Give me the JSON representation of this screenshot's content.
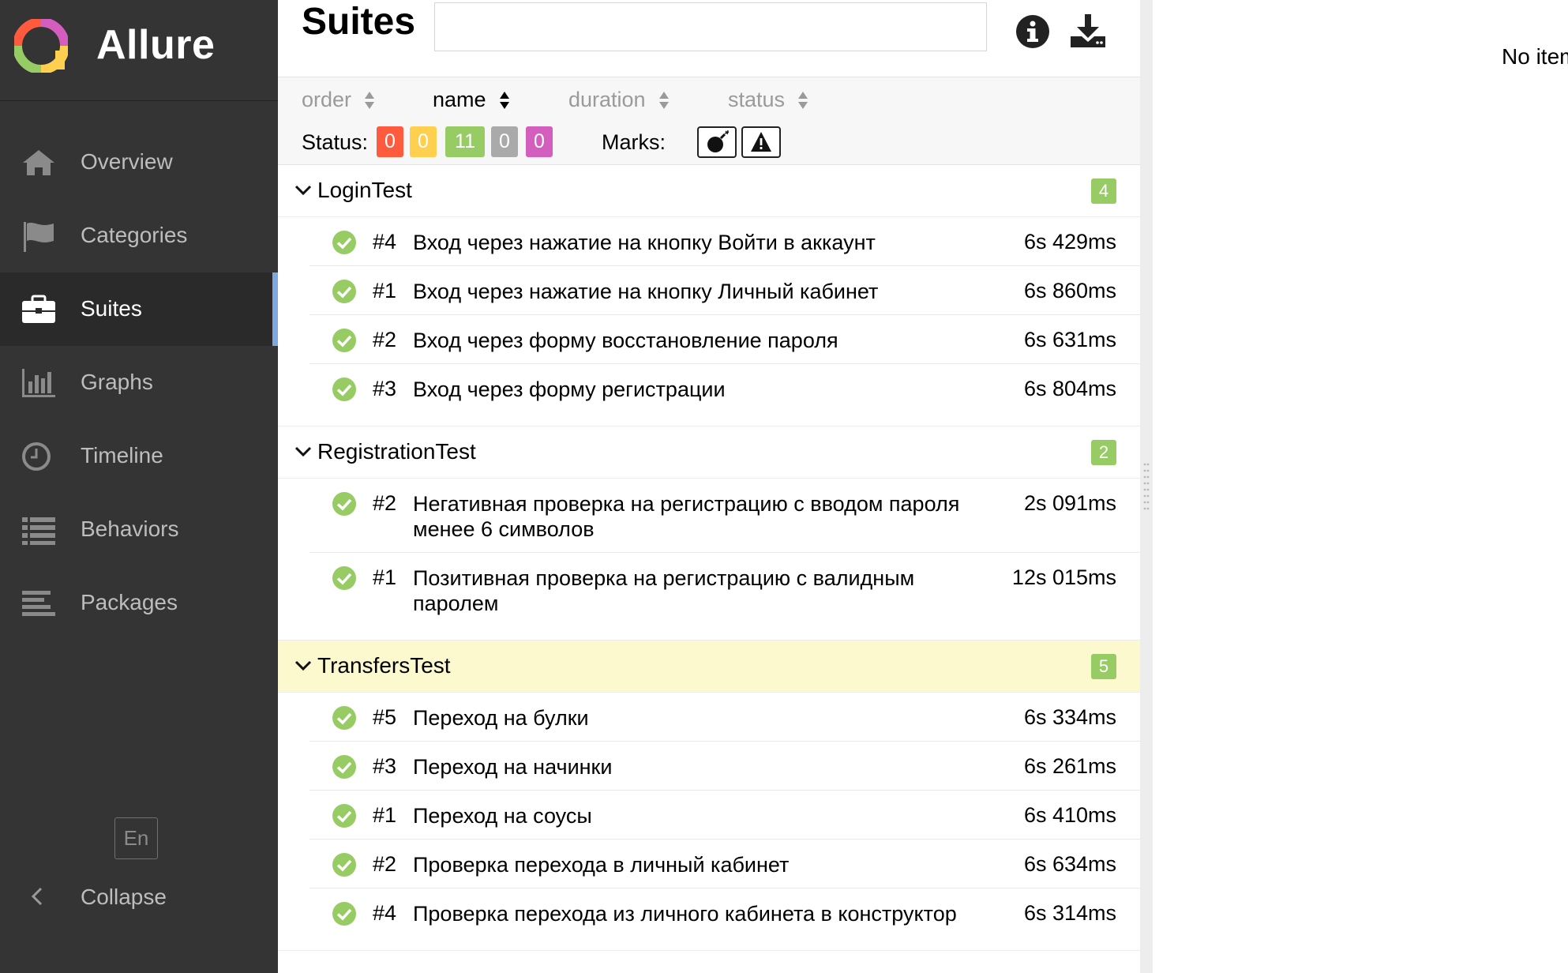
{
  "app": {
    "name": "Allure"
  },
  "sidebar": {
    "items": [
      {
        "label": "Overview",
        "icon": "home-icon"
      },
      {
        "label": "Categories",
        "icon": "flag-icon"
      },
      {
        "label": "Suites",
        "icon": "briefcase-icon",
        "active": true
      },
      {
        "label": "Graphs",
        "icon": "bar-chart-icon"
      },
      {
        "label": "Timeline",
        "icon": "clock-icon"
      },
      {
        "label": "Behaviors",
        "icon": "list-icon"
      },
      {
        "label": "Packages",
        "icon": "align-left-icon"
      }
    ],
    "language": "En",
    "collapse_label": "Collapse"
  },
  "suites_pane": {
    "title": "Suites",
    "search": {
      "value": "",
      "placeholder": ""
    },
    "sorters": [
      {
        "label": "order",
        "active": false
      },
      {
        "label": "name",
        "active": true
      },
      {
        "label": "duration",
        "active": false
      },
      {
        "label": "status",
        "active": false
      }
    ],
    "status_label": "Status:",
    "statuses": [
      {
        "name": "failed",
        "count": "0",
        "color": "#fd5a3e"
      },
      {
        "name": "broken",
        "count": "0",
        "color": "#ffd050"
      },
      {
        "name": "passed",
        "count": "11",
        "color": "#97cc64"
      },
      {
        "name": "skipped",
        "count": "0",
        "color": "#aaaaaa"
      },
      {
        "name": "unknown",
        "count": "0",
        "color": "#d35ebe"
      }
    ],
    "marks_label": "Marks:",
    "groups": [
      {
        "name": "LoginTest",
        "count": "4",
        "highlighted": false,
        "tests": [
          {
            "num": "#4",
            "name": "Вход через нажатие на кнопку Войти в аккаунт",
            "duration": "6s 429ms"
          },
          {
            "num": "#1",
            "name": "Вход через нажатие на кнопку Личный кабинет",
            "duration": "6s 860ms"
          },
          {
            "num": "#2",
            "name": "Вход через форму восстановление пароля",
            "duration": "6s 631ms"
          },
          {
            "num": "#3",
            "name": "Вход через форму регистрации",
            "duration": "6s 804ms"
          }
        ]
      },
      {
        "name": "RegistrationTest",
        "count": "2",
        "highlighted": false,
        "tests": [
          {
            "num": "#2",
            "name": "Негативная проверка на регистрацию с вводом пароля менее 6 символов",
            "duration": "2s 091ms"
          },
          {
            "num": "#1",
            "name": "Позитивная проверка на регистрацию с валидным паролем",
            "duration": "12s 015ms"
          }
        ]
      },
      {
        "name": "TransfersTest",
        "count": "5",
        "highlighted": true,
        "tests": [
          {
            "num": "#5",
            "name": "Переход на булки",
            "duration": "6s 334ms"
          },
          {
            "num": "#3",
            "name": "Переход на начинки",
            "duration": "6s 261ms"
          },
          {
            "num": "#1",
            "name": "Переход на соусы",
            "duration": "6s 410ms"
          },
          {
            "num": "#2",
            "name": "Проверка перехода в личный кабинет",
            "duration": "6s 634ms"
          },
          {
            "num": "#4",
            "name": "Проверка перехода из личного кабинета в конструктор",
            "duration": "6s 314ms"
          }
        ]
      }
    ]
  },
  "detail_pane": {
    "empty_text": "No items are selected"
  }
}
